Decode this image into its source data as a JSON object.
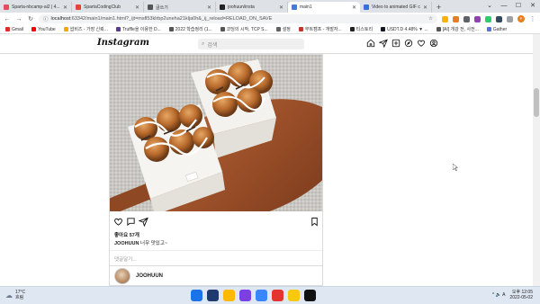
{
  "browser": {
    "tabs": [
      {
        "label": "Sparta-nbcamp-ai2 | 4...",
        "color": "#e84a5f",
        "active": false
      },
      {
        "label": "SpartaCodingClub",
        "color": "#e8423f",
        "active": false
      },
      {
        "label": "글쓰기",
        "color": "#555555",
        "active": false
      },
      {
        "label": "joohuun/insta",
        "color": "#222222",
        "active": false
      },
      {
        "label": "main1",
        "color": "#4a7bd0",
        "active": true
      },
      {
        "label": "Video to animated GIF co...",
        "color": "#3a6fd8",
        "active": false
      }
    ],
    "new_tab": "+",
    "window_controls": [
      "⌄",
      "—",
      "☐",
      "✕"
    ],
    "url_host": "localhost",
    "url_rest": ":63342/main1/main1.html?_ijt=msfl53klrbp2uneha21klja0h&_ij_reload=RELOAD_ON_SAVE",
    "bookmarks": [
      {
        "label": "Gmail",
        "color": "#d93025"
      },
      {
        "label": "YouTube",
        "color": "#ff0000"
      },
      {
        "label": "쌉비즈 - 가장 신뢰...",
        "color": "#f2a900"
      },
      {
        "label": "Truffle을 이용한 D...",
        "color": "#5b3c8c"
      },
      {
        "label": "2022 학습정리 (1...",
        "color": "#555555"
      },
      {
        "label": "코딩의 시작, TCP S...",
        "color": "#555555"
      },
      {
        "label": "설정",
        "color": "#5f6368"
      },
      {
        "label": "부트캠프 - 개발자...",
        "color": "#c0392b"
      },
      {
        "label": "티스토리",
        "color": "#222222"
      },
      {
        "label": "USDT.D 4.48% ▼ ...",
        "color": "#131722"
      },
      {
        "label": "[AI] 개강 전, 사전...",
        "color": "#555555"
      },
      {
        "label": "Gather",
        "color": "#5a6fd8"
      }
    ]
  },
  "instagram": {
    "logo": "Instagram",
    "search_placeholder": "검색",
    "nav_icons": [
      "home-icon",
      "send-icon",
      "new-post-icon",
      "explore-icon",
      "heart-icon",
      "profile-icon"
    ],
    "post": {
      "likes": "좋아요 57개",
      "caption_user": "JOOHUUN",
      "caption_text": "너무 맛있고~",
      "comment_placeholder": "댓글달기...",
      "author": "JOOHUUN"
    }
  },
  "taskbar": {
    "temperature": "17°C",
    "weather": "흐림",
    "app_colors": [
      "#1a73e8",
      "#1e3a6e",
      "#ffb900",
      "#7b3fe4",
      "#3a86ff",
      "#e3342f",
      "#f6c90e",
      "#111111"
    ],
    "tray": "^ 🔈 A",
    "time": "오후 12:05",
    "date": "2022-05-02"
  }
}
